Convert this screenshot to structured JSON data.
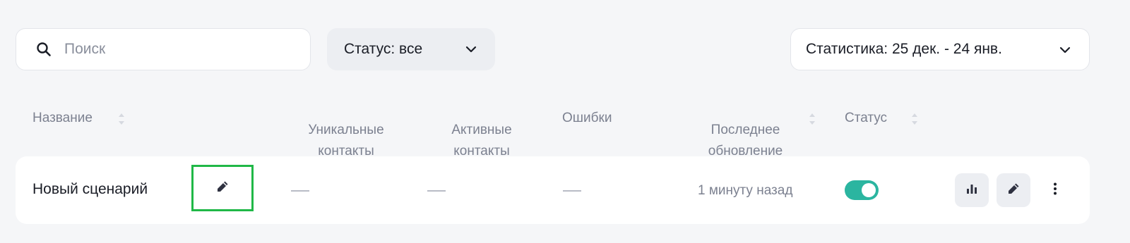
{
  "toolbar": {
    "search": {
      "placeholder": "Поиск",
      "value": ""
    },
    "status_filter": {
      "label": "Статус: все"
    },
    "stats_filter": {
      "label": "Статистика: 25 дек. - 24 янв."
    }
  },
  "table": {
    "columns": [
      {
        "label": "Название",
        "sortable": true
      },
      {
        "label": "Уникальные\nконтакты",
        "sortable": false
      },
      {
        "label": "Активные\nконтакты",
        "sortable": false
      },
      {
        "label": "Ошибки",
        "sortable": false
      },
      {
        "label": "Последнее\nобновление",
        "sortable": true
      },
      {
        "label": "Статус",
        "sortable": true
      }
    ],
    "rows": [
      {
        "name": "Новый сценарий",
        "unique_contacts": "—",
        "active_contacts": "—",
        "errors": "—",
        "last_update": "1 минуту назад",
        "status_enabled": true
      }
    ]
  },
  "icons": {
    "search": "search-icon",
    "chevron": "chevron-down-icon",
    "sort": "sort-icon",
    "edit": "pencil-icon",
    "stats": "bar-chart-icon",
    "more": "more-vertical-icon"
  },
  "colors": {
    "background": "#f5f6f8",
    "toggle_on": "#2bb5a0",
    "highlight": "#20b847",
    "muted_text": "#7c8190"
  }
}
